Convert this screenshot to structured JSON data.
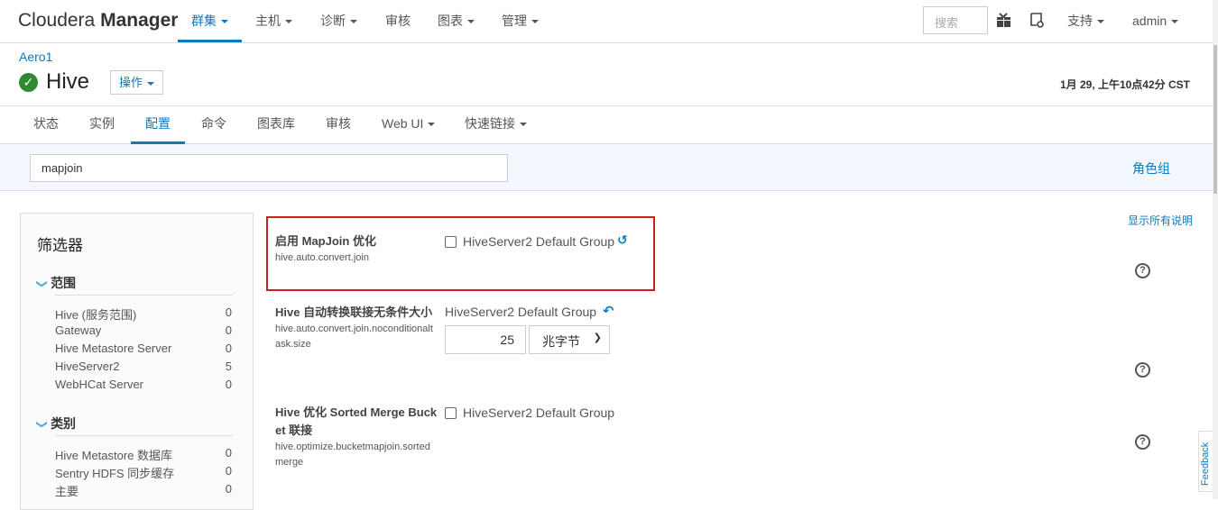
{
  "app": {
    "logo_light": "Cloudera",
    "logo_bold": "Manager"
  },
  "topnav": [
    {
      "label": "群集",
      "dropdown": true,
      "active": true
    },
    {
      "label": "主机",
      "dropdown": true
    },
    {
      "label": "诊断",
      "dropdown": true
    },
    {
      "label": "审核"
    },
    {
      "label": "图表",
      "dropdown": true
    },
    {
      "label": "管理",
      "dropdown": true
    }
  ],
  "search_placeholder": "搜索",
  "support": "支持",
  "user": "admin",
  "icons": {
    "gift": "gift-icon",
    "tasks": "running-commands-icon"
  },
  "breadcrumb": "Aero1",
  "service": {
    "name": "Hive",
    "status": "good",
    "status_color": "#2e8b2e",
    "actions": "操作"
  },
  "timestamp": "1月 29, 上午10点42分 CST",
  "tabs": [
    {
      "label": "状态"
    },
    {
      "label": "实例"
    },
    {
      "label": "配置",
      "active": true
    },
    {
      "label": "命令"
    },
    {
      "label": "图表库"
    },
    {
      "label": "审核"
    },
    {
      "label": "Web UI",
      "dropdown": true
    },
    {
      "label": "快速链接",
      "dropdown": true
    }
  ],
  "filter_input": "mapjoin",
  "role_groups": "角色组",
  "show_all_desc": "显示所有说明",
  "filters": {
    "title": "筛选器",
    "scope": {
      "label": "范围",
      "items": [
        {
          "label": "Hive (服务范围)",
          "count": "0"
        },
        {
          "label": "Gateway",
          "count": "0"
        },
        {
          "label": "Hive Metastore Server",
          "count": "0"
        },
        {
          "label": "HiveServer2",
          "count": "5"
        },
        {
          "label": "WebHCat Server",
          "count": "0"
        }
      ]
    },
    "category": {
      "label": "类别",
      "items": [
        {
          "label": "Hive Metastore 数据库",
          "count": "0"
        },
        {
          "label": "Sentry HDFS 同步缓存",
          "count": "0"
        },
        {
          "label": "主要",
          "count": "0"
        }
      ]
    }
  },
  "props": [
    {
      "title": "启用 MapJoin 优化",
      "key": "hive.auto.convert.join",
      "group": "HiveServer2 Default Group",
      "checked": false,
      "highlight_color": "#cc1f1f"
    },
    {
      "title": "Hive 自动转换联接无条件大小",
      "key": "hive.auto.convert.join.noconditionaltask.size",
      "group": "HiveServer2 Default Group",
      "value": "25",
      "unit": "兆字节"
    },
    {
      "title": "Hive 优化 Sorted Merge Bucket 联接",
      "key": "hive.optimize.bucketmapjoin.sortedmerge",
      "group": "HiveServer2 Default Group",
      "checked": false
    }
  ],
  "feedback": "Feedback"
}
